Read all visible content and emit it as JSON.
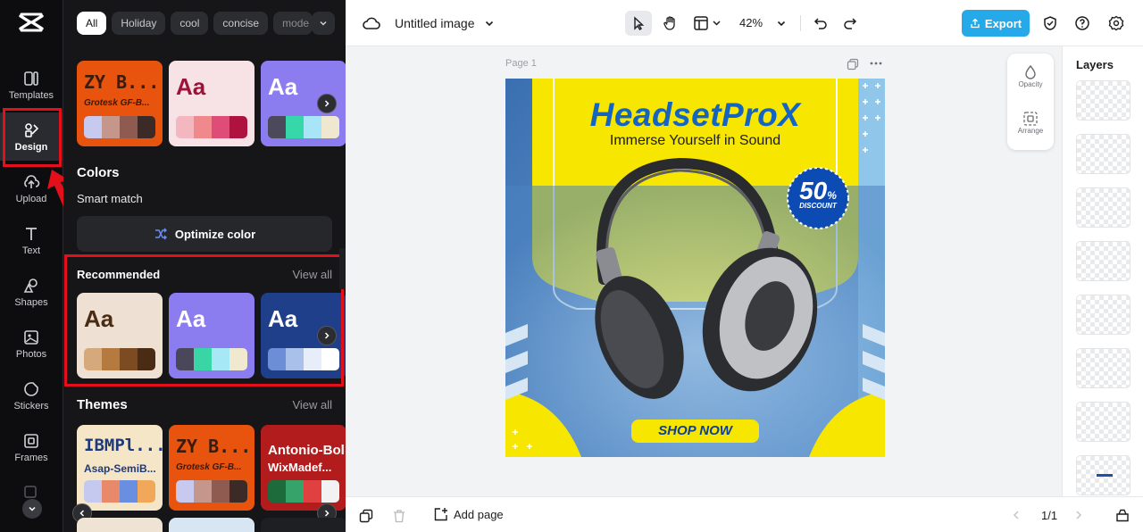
{
  "rail": {
    "items": [
      {
        "label": "Templates",
        "icon": "templates-icon"
      },
      {
        "label": "Design",
        "icon": "design-icon"
      },
      {
        "label": "Upload",
        "icon": "upload-icon"
      },
      {
        "label": "Text",
        "icon": "text-icon"
      },
      {
        "label": "Shapes",
        "icon": "shapes-icon"
      },
      {
        "label": "Photos",
        "icon": "photos-icon"
      },
      {
        "label": "Stickers",
        "icon": "stickers-icon"
      },
      {
        "label": "Frames",
        "icon": "frames-icon"
      }
    ]
  },
  "filters": {
    "chips": [
      "All",
      "Holiday",
      "cool",
      "concise",
      "mode"
    ]
  },
  "top_cards": [
    {
      "title": "ZY B...",
      "subtitle": "Grotesk GF-B...",
      "colors": [
        "#c8c9ef",
        "#c4968c",
        "#8f5a4f",
        "#3c2a27"
      ],
      "bg": "#e8530e"
    },
    {
      "title": "Aa",
      "colors": [
        "#f4b6bf",
        "#f0898c",
        "#e04c78",
        "#b0123f"
      ],
      "bg": "#f7e3e6"
    },
    {
      "title": "Aa",
      "colors": [
        "#4c4a5a",
        "#36d7a8",
        "#a8e6f7",
        "#efe7cf"
      ],
      "bg": "#8b7cf0"
    }
  ],
  "colors_section": {
    "title": "Colors",
    "smart_match": "Smart match",
    "optimize_label": "Optimize color"
  },
  "recommended": {
    "title": "Recommended",
    "view_all": "View all",
    "cards": [
      {
        "title": "Aa",
        "colors": [
          "#d6a97c",
          "#b57a3f",
          "#7d4b22",
          "#4a2b14"
        ],
        "bg": "#efe0d4"
      },
      {
        "title": "Aa",
        "colors": [
          "#4a475a",
          "#39d5a4",
          "#a6e8f6",
          "#f0e8cf"
        ],
        "bg": "#8b7cf0"
      },
      {
        "title": "Aa",
        "colors": [
          "#6b8ed6",
          "#a9c0ea",
          "#e8eef9",
          "#ffffff"
        ],
        "bg": "#1f3f8a"
      }
    ]
  },
  "themes": {
    "title": "Themes",
    "view_all": "View all",
    "cards": [
      {
        "title": "IBMPl...",
        "subtitle": "Asap-SemiB...",
        "colors": [
          "#c6c9ef",
          "#e88a6a",
          "#6a8ee0",
          "#f2a85a"
        ],
        "bg": "#f6e6c8"
      },
      {
        "title": "ZY B...",
        "subtitle": "Grotesk GF-B...",
        "colors": [
          "#c8c9ef",
          "#c4968c",
          "#8f5a4f",
          "#3c2a27"
        ],
        "bg": "#e8530e"
      },
      {
        "title": "Antonio-Bol",
        "subtitle": "WixMadef...",
        "colors": [
          "#1d6b3a",
          "#35a36a",
          "#e04040",
          "#f2f2f2"
        ],
        "bg": "#b31c1c"
      }
    ]
  },
  "topbar": {
    "title": "Untitled image",
    "zoom": "42%",
    "export_label": "Export"
  },
  "canvas": {
    "page_label": "Page 1",
    "poster": {
      "headline": "HeadsetProX",
      "tagline": "Immerse Yourself in Sound",
      "discount_value": "50",
      "discount_percent": "%",
      "discount_label": "DISCOUNT",
      "cta": "SHOP NOW"
    },
    "tools": [
      {
        "label": "Opacity",
        "icon": "opacity-icon"
      },
      {
        "label": "Arrange",
        "icon": "arrange-icon"
      }
    ]
  },
  "layers": {
    "title": "Layers"
  },
  "bottombar": {
    "add_page": "Add page",
    "page_count": "1/1"
  },
  "colors": {
    "accent": "#25a9e9",
    "highlight": "#e3101b",
    "poster_yellow": "#f6e600",
    "poster_blue": "#4d89c8"
  }
}
